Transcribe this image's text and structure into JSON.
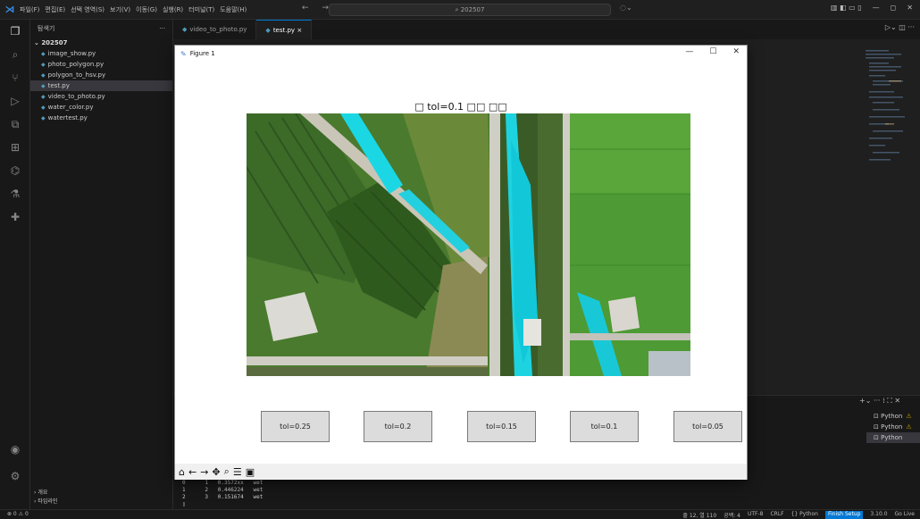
{
  "titlebar": {
    "menu": [
      "파일(F)",
      "편집(E)",
      "선택 영역(S)",
      "보기(V)",
      "이동(G)",
      "실행(R)",
      "터미널(T)",
      "도움말(H)"
    ],
    "search": "202507",
    "nav": "← →"
  },
  "activity": [
    "explorer-icon",
    "search-icon",
    "source-control-icon",
    "run-debug-icon",
    "remote-icon",
    "extensions-icon",
    "chat-icon",
    "testing-icon",
    "python-icon",
    "account-icon",
    "settings-icon"
  ],
  "sidebar": {
    "title": "탐색기",
    "more": "···",
    "folder": "202507",
    "files": [
      "image_show.py",
      "photo_polygon.py",
      "polygon_to_hsv.py",
      "test.py",
      "video_to_photo.py",
      "water_color.py",
      "watertest.py"
    ],
    "active_file": "test.py",
    "outline": "개요",
    "timeline": "타임라인"
  },
  "tabs": [
    {
      "label": "video_to_photo.py"
    },
    {
      "label": "test.py",
      "close": "×"
    }
  ],
  "figure": {
    "window_title": "Figure 1",
    "plot_title": "□ tol=0.1 □□ □□",
    "buttons": [
      "tol=0.25",
      "tol=0.2",
      "tol=0.15",
      "tol=0.1",
      "tol=0.05"
    ],
    "toolbar_icons": [
      "home-icon",
      "back-icon",
      "forward-icon",
      "pan-icon",
      "zoom-icon",
      "configure-icon",
      "save-icon"
    ]
  },
  "terminal": {
    "rows": [
      [
        "0",
        "1",
        "0.3572xx",
        "wet"
      ],
      [
        "1",
        "2",
        "0.446224",
        "wet"
      ],
      [
        "2",
        "3",
        "0.151674",
        "wet"
      ]
    ],
    "cursor": "▯",
    "sessions": [
      "Python",
      "Python",
      "Python"
    ],
    "warn": "⚠"
  },
  "statusbar": {
    "left": "⊗ 0  ⚠ 0",
    "items": [
      "줄 12, 열 110",
      "공백: 4",
      "UTF-8",
      "CRLF",
      "{} Python",
      "Finish Setup",
      "3.10.0",
      "Go Live"
    ],
    "highlight": "Finish Setup"
  },
  "colors": {
    "accent": "#0078d4",
    "water_overlay": "#19d9e6",
    "field_green": "#4a8a2a"
  }
}
